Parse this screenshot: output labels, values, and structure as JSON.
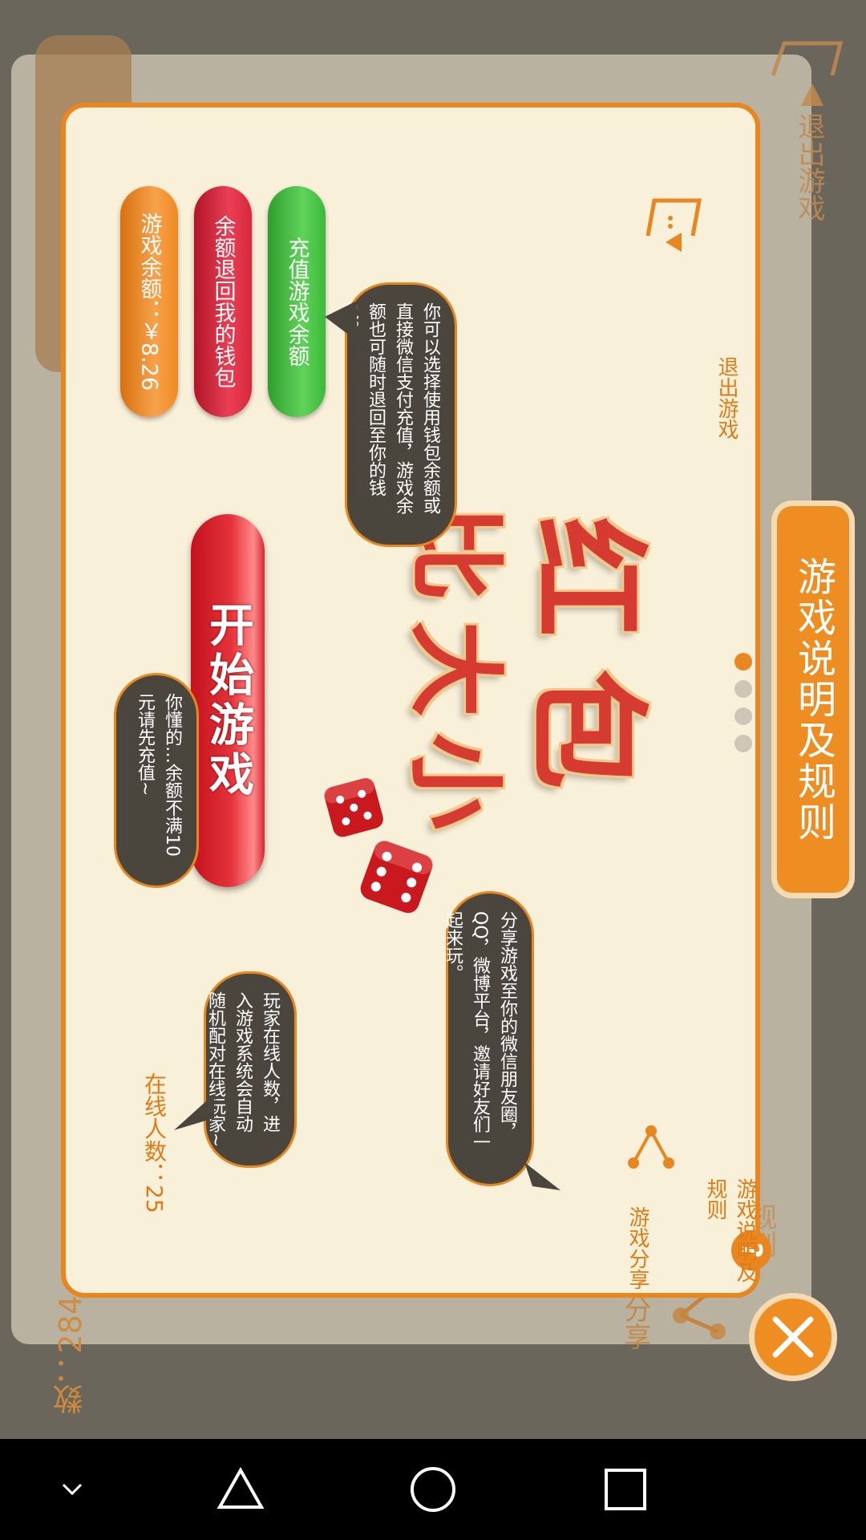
{
  "backdrop": {
    "exit_label": "退出游戏",
    "online_count": "数：284",
    "share_label": "分享",
    "rules_label": "规则"
  },
  "dialog": {
    "exit_label": "退出游戏",
    "help_label": "游戏说明及规则",
    "share_label": "游戏分享",
    "title_chars": [
      "红",
      "包",
      "比",
      "大",
      "小"
    ],
    "buttons": {
      "recharge": "充值游戏余额",
      "refund": "余额退回我的钱包",
      "balance": "游戏余额：￥8.26",
      "start": "开始游戏"
    },
    "tips": {
      "recharge": "你可以选择使用钱包余额或直接微信支付充值，游戏余额也可随时退回至你的钱包。",
      "start": "你懂的…余额不满10元请先充值~",
      "share": "分享游戏至你的微信朋友圈，QQ，微博平台，邀请好友们一起来玩。",
      "online": "玩家在线人数，进入游戏系统会自动随机配对在线玩家~"
    },
    "online_label": "在线人数：25",
    "page_dots": 4,
    "active_dot": 1
  },
  "side_tab": {
    "label": "游戏说明及规则"
  },
  "colors": {
    "accent": "#ee8d21",
    "panel": "#f9f0da",
    "bubble": "#4a463e",
    "green": "#3cb93a",
    "red": "#d8283b",
    "orange": "#ef8a22"
  },
  "navbar": {
    "icons": [
      "chevron-down-icon",
      "back-triangle-icon",
      "home-circle-icon",
      "recents-square-icon"
    ]
  }
}
